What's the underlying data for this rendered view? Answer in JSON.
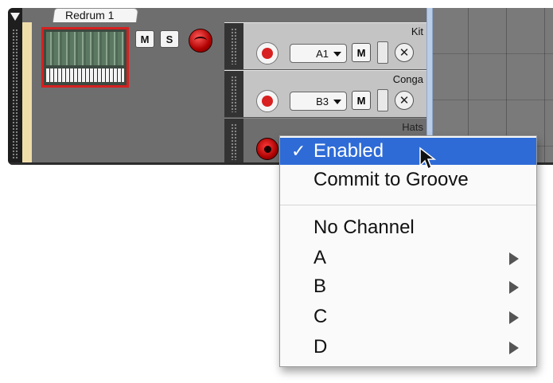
{
  "device": {
    "track_name": "Redrum 1",
    "mute_label": "M",
    "solo_label": "S"
  },
  "channels": [
    {
      "name": "Kit",
      "note": "A1",
      "mute_label": "M",
      "close_glyph": "✕"
    },
    {
      "name": "Conga",
      "note": "B3",
      "mute_label": "M",
      "close_glyph": "✕"
    },
    {
      "name": "Hats"
    }
  ],
  "context_menu": {
    "check_glyph": "✓",
    "items": [
      {
        "label": "Enabled",
        "checked": true,
        "highlighted": true
      },
      {
        "label": "Commit to Groove"
      },
      {
        "label": "No Channel"
      },
      {
        "label": "A",
        "submenu": true
      },
      {
        "label": "B",
        "submenu": true
      },
      {
        "label": "C",
        "submenu": true
      },
      {
        "label": "D",
        "submenu": true
      }
    ]
  },
  "colors": {
    "highlight": "#2e6bd6",
    "record_red": "#d82020",
    "panel_gray": "#6e6e6e",
    "cream": "#f0deaa"
  },
  "icons": [
    "collapse-triangle-icon",
    "record-icon",
    "led-icon",
    "close-x-icon",
    "dropdown-arrow-icon",
    "submenu-arrow-icon",
    "mouse-pointer-icon",
    "checkmark-icon"
  ]
}
